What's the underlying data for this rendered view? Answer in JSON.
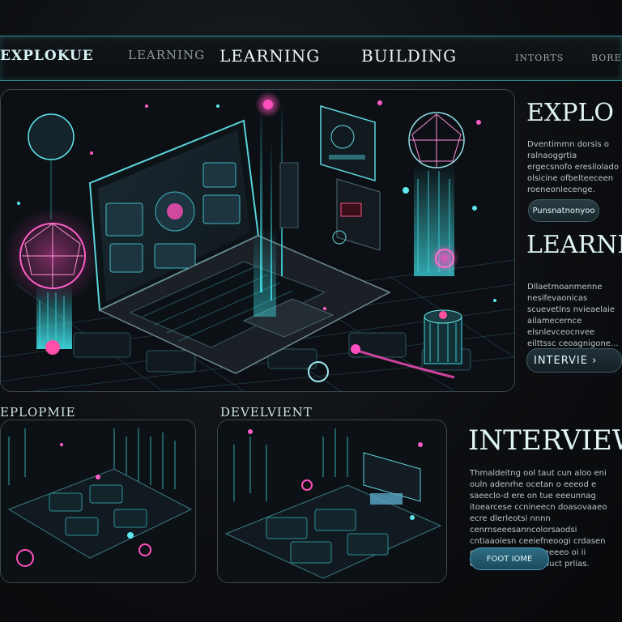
{
  "nav": {
    "items": [
      "EXPLOKUE",
      "LEARNING",
      "LEARNING",
      "BUILDING",
      "INTORTS",
      "BORE"
    ]
  },
  "side": {
    "explore_heading": "EXPLO",
    "explore_text": "Dventimmn dorsis o ralnaoggrtia ergecsnofo eresilolado olsicine ofbelteeceen roeneonlecenge.",
    "explore_button": "Punsnatnonyoo",
    "learning_heading": "LEARNI",
    "learning_text": "Dllaetmoanmenne nesifevaonicas scuevetlns nvieaelaie ailamecernce elsnlevceocnvee eilttssc ceoagnigone...",
    "learning_button": "INTERVIE ›"
  },
  "cards": {
    "card1_label": "EPLOPMIE",
    "card2_label": "DEVELVIENT"
  },
  "interview": {
    "heading": "INTERVIEW",
    "text": "Thmaldeitng ool taut cun aloo eni ouln adenrhe ocetan o eeeod e saeeclo-d ere on tue eeeunnag itoearcese ccnineecn doasovaaeo ecre dlerleotsi nnnn cenrnseeesanncolorsaodsi cntiaaoiesn ceeiefneoogi crdasen cnttoole oiuseiiocreeeeo oi ii cnneeco daeo heonuct prlias.",
    "button": "FOOT IOME"
  },
  "colors": {
    "cyan": "#3fe0e6",
    "magenta": "#ff3fae",
    "background": "#0b0d10"
  }
}
